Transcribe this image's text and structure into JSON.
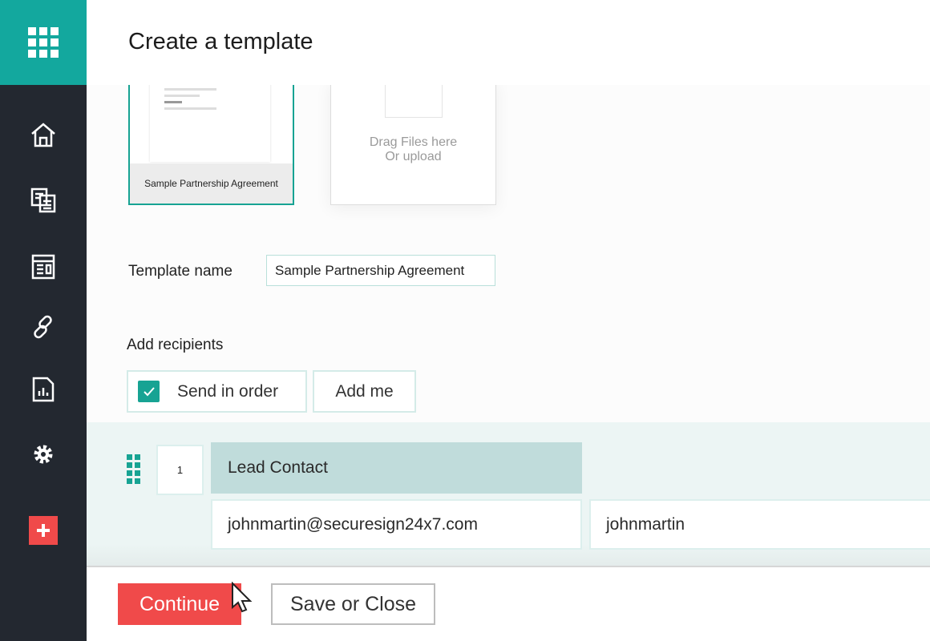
{
  "header": {
    "title": "Create a template"
  },
  "sidebar": {
    "items": [
      {
        "icon": "home-icon"
      },
      {
        "icon": "documents-icon"
      },
      {
        "icon": "templates-icon"
      },
      {
        "icon": "link-icon"
      },
      {
        "icon": "reports-icon"
      },
      {
        "icon": "settings-icon"
      },
      {
        "icon": "plus-icon"
      }
    ]
  },
  "documents": {
    "selected_name": "Sample Partnership Agreement",
    "upload_line1": "Drag Files here",
    "upload_line2": "Or upload"
  },
  "template_name": {
    "label": "Template name",
    "value": "Sample Partnership Agreement"
  },
  "recipients": {
    "label": "Add recipients",
    "send_in_order": "Send in order",
    "send_in_order_checked": true,
    "add_me": "Add me",
    "list": [
      {
        "order": "1",
        "role": "Lead Contact",
        "email": "johnmartin@securesign24x7.com",
        "name": "johnmartin"
      }
    ]
  },
  "footer": {
    "continue": "Continue",
    "save_or_close": "Save or Close"
  },
  "colors": {
    "accent": "#13a89e",
    "sidebar": "#232830",
    "primary_button": "#f04a4a"
  }
}
